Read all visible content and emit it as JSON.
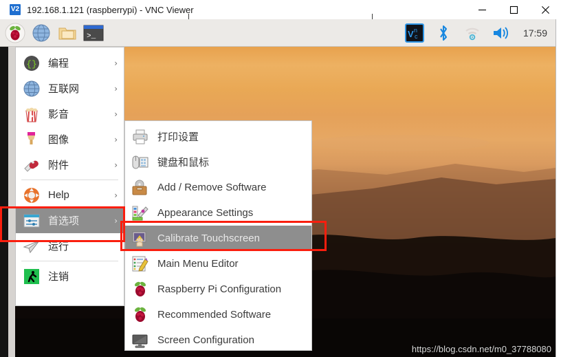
{
  "window": {
    "title": "192.168.1.121 (raspberrypi) - VNC Viewer",
    "app_icon_text": "V2",
    "controls": {
      "minimize": "minimize",
      "maximize": "maximize",
      "close": "close"
    }
  },
  "panel": {
    "launchers": [
      {
        "name": "raspberry-menu-icon",
        "label": "Raspberry Pi Menu"
      },
      {
        "name": "web-browser-icon",
        "label": "Web Browser"
      },
      {
        "name": "file-manager-icon",
        "label": "File Manager"
      },
      {
        "name": "terminal-icon",
        "label": "Terminal"
      }
    ],
    "tray": [
      {
        "name": "vnc-server-icon",
        "label": "VNC Server"
      },
      {
        "name": "bluetooth-icon",
        "label": "Bluetooth"
      },
      {
        "name": "wifi-icon",
        "label": "Wireless & Wired Network"
      },
      {
        "name": "volume-icon",
        "label": "Volume"
      }
    ],
    "clock": "17:59"
  },
  "main_menu": {
    "items": [
      {
        "label": "编程",
        "icon": "programming-icon",
        "arrow": "›",
        "selected": false
      },
      {
        "label": "互联网",
        "icon": "internet-globe-icon",
        "arrow": "›",
        "selected": false
      },
      {
        "label": "影音",
        "icon": "media-popcorn-icon",
        "arrow": "›",
        "selected": false
      },
      {
        "label": "图像",
        "icon": "graphics-paintbrush-icon",
        "arrow": "›",
        "selected": false
      },
      {
        "label": "附件",
        "icon": "accessories-knife-icon",
        "arrow": "›",
        "selected": false
      },
      {
        "label": "Help",
        "icon": "help-lifebuoy-icon",
        "arrow": "›",
        "selected": false
      },
      {
        "label": "首选项",
        "icon": "preferences-sliders-icon",
        "arrow": "›",
        "selected": true
      },
      {
        "label": "运行",
        "icon": "run-paperplane-icon",
        "arrow": "",
        "selected": false
      },
      {
        "label": "注销",
        "icon": "logout-exit-icon",
        "arrow": "",
        "selected": false
      }
    ]
  },
  "submenu": {
    "items": [
      {
        "label": "打印设置",
        "icon": "printer-icon",
        "selected": false
      },
      {
        "label": "键盘和鼠标",
        "icon": "keyboard-mouse-icon",
        "selected": false
      },
      {
        "label": "Add / Remove Software",
        "icon": "software-box-icon",
        "selected": false
      },
      {
        "label": "Appearance Settings",
        "icon": "appearance-palette-icon",
        "selected": false
      },
      {
        "label": "Calibrate Touchscreen",
        "icon": "touchscreen-hand-icon",
        "selected": true
      },
      {
        "label": "Main Menu Editor",
        "icon": "menu-editor-pencil-icon",
        "selected": false
      },
      {
        "label": "Raspberry Pi Configuration",
        "icon": "raspberry-icon",
        "selected": false
      },
      {
        "label": "Recommended Software",
        "icon": "raspberry-icon",
        "selected": false
      },
      {
        "label": "Screen Configuration",
        "icon": "monitor-icon",
        "selected": false
      }
    ]
  },
  "annotations": {
    "highlight_color": "#fa1e0e",
    "boxes": [
      {
        "name": "preferences-highlight",
        "target": "首选项"
      },
      {
        "name": "calibrate-touchscreen-highlight",
        "target": "Calibrate Touchscreen"
      }
    ]
  },
  "wallpaper": {
    "watermark": "https://blog.csdn.net/m0_37788080"
  }
}
